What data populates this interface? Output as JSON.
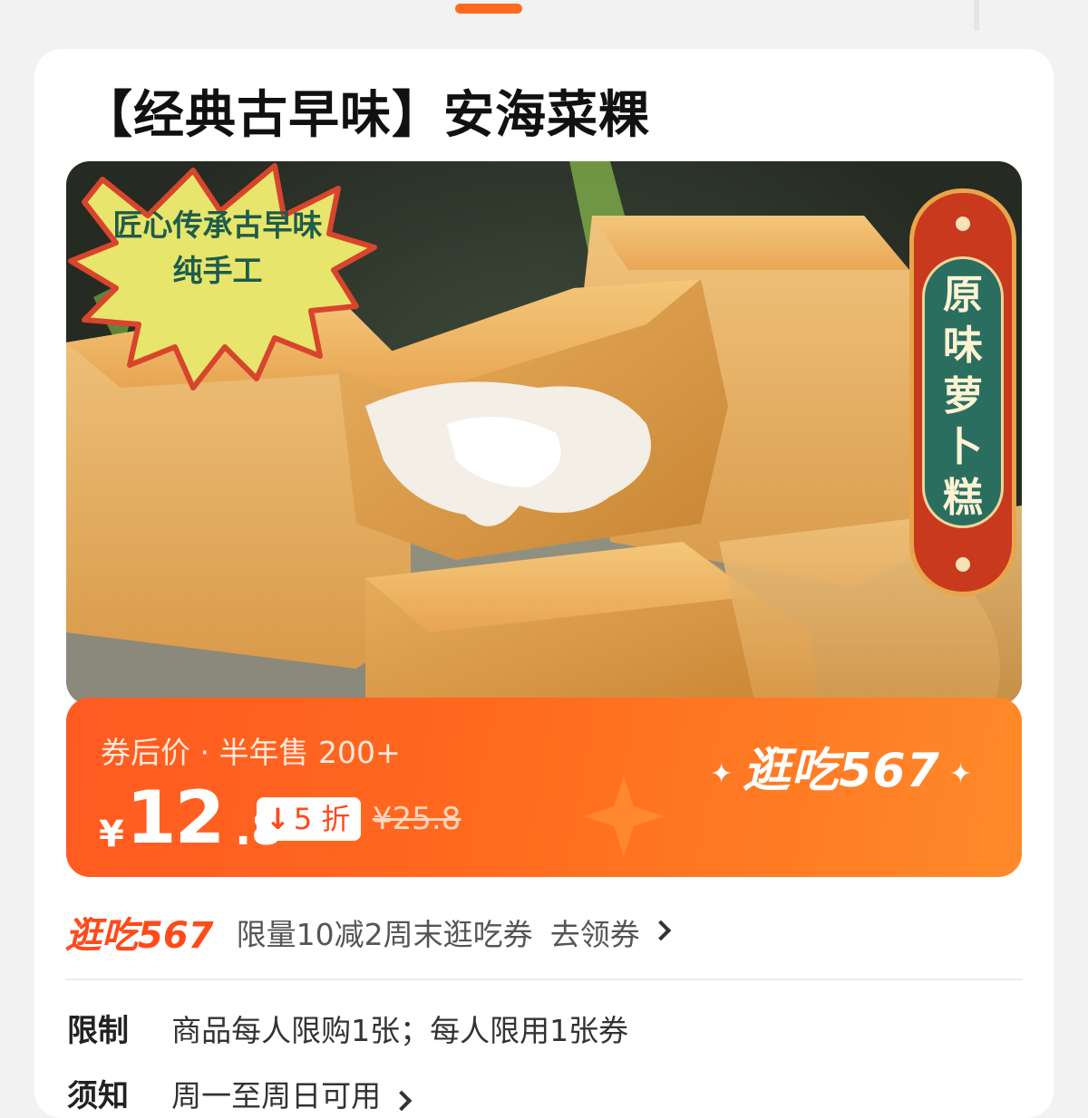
{
  "product": {
    "title": "【经典古早味】安海菜粿"
  },
  "hero": {
    "burst_line1": "匠心传承古早味",
    "burst_line2": "纯手工",
    "banner_text": "原味萝卜糕"
  },
  "price": {
    "meta": "券后价 · 半年售 200+",
    "currency": "¥",
    "integer": "12",
    "decimal": ".8",
    "discount_arrow": "↓",
    "discount": "5 折",
    "original": "¥25.8",
    "promo_logo": "逛吃567"
  },
  "coupon": {
    "logo": "逛吃567",
    "text": "限量10减2周末逛吃券",
    "link": "去领券"
  },
  "details": [
    {
      "label": "限制",
      "value": "商品每人限购1张；每人限用1张券"
    },
    {
      "label": "须知",
      "value": "周一至周日可用"
    }
  ],
  "colors": {
    "accent": "#ff5a22",
    "accent_light": "#ff8a2a",
    "banner_red": "#c8391d",
    "banner_green": "#2a6e60"
  }
}
